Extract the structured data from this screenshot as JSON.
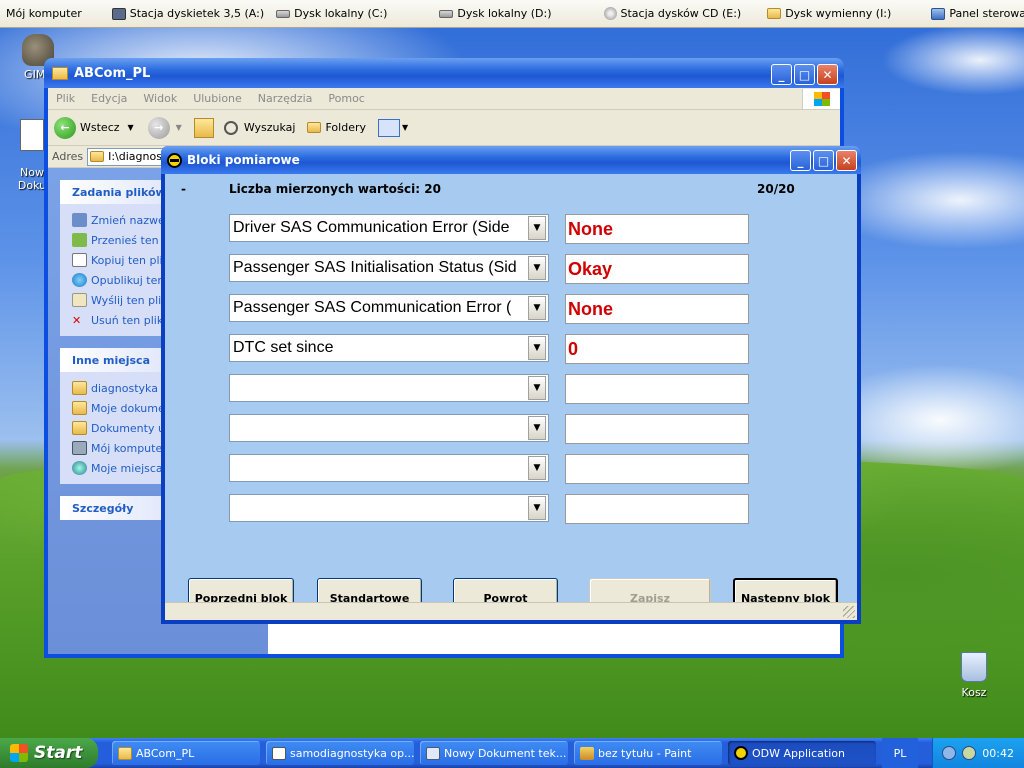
{
  "topbar": {
    "items": [
      {
        "label": "Mój komputer",
        "icon": "computer-icon"
      },
      {
        "label": "Stacja dyskietek 3,5 (A:)",
        "icon": "floppy-icon"
      },
      {
        "label": "Dysk lokalny (C:)",
        "icon": "drive-icon"
      },
      {
        "label": "Dysk lokalny (D:)",
        "icon": "drive-icon"
      },
      {
        "label": "Stacja dysków CD (E:)",
        "icon": "cd-icon"
      },
      {
        "label": "Dysk wymienny (I:)",
        "icon": "folder-icon"
      },
      {
        "label": "Panel sterowania",
        "icon": "control-panel-icon"
      }
    ]
  },
  "desktop_icons": [
    {
      "label": "GIMP"
    },
    {
      "label": "Now\nDoku"
    }
  ],
  "recycle_bin": {
    "label": "Kosz"
  },
  "explorer": {
    "title": "ABCom_PL",
    "menu": [
      "Plik",
      "Edycja",
      "Widok",
      "Ulubione",
      "Narzędzia",
      "Pomoc"
    ],
    "toolbar": {
      "back": "Wstecz",
      "search": "Wyszukaj",
      "folders": "Foldery"
    },
    "address_label": "Adres",
    "address_value": "I:\\diagnost",
    "file_tasks": {
      "title": "Zadania plików",
      "items": [
        "Zmień nazwę",
        "Przenieś ten p",
        "Kopiuj ten plik",
        "Opublikuj ten",
        "Wyślij ten plik",
        "Usuń ten plik"
      ]
    },
    "other_places": {
      "title": "Inne miejsca",
      "items": [
        "diagnostyka",
        "Moje dokume",
        "Dokumenty u",
        "Mój komputer",
        "Moje miejsca"
      ]
    },
    "details": {
      "title": "Szczegóły"
    }
  },
  "dialog": {
    "title": "Bloki pomiarowe",
    "dash": "-",
    "count_label": "Liczba mierzonych wartości: 20",
    "progress": "20/20",
    "rows": [
      {
        "name": "Driver SAS Communication Error (Side",
        "value": "None"
      },
      {
        "name": "Passenger SAS Initialisation Status (Sid",
        "value": "Okay"
      },
      {
        "name": "Passenger SAS Communication Error (",
        "value": "None"
      },
      {
        "name": "DTC set since",
        "value": "0"
      },
      {
        "name": "",
        "value": ""
      },
      {
        "name": "",
        "value": ""
      },
      {
        "name": "",
        "value": ""
      },
      {
        "name": "",
        "value": ""
      }
    ],
    "buttons": {
      "prev": "Poprzedni blok",
      "standard": "Standartowe",
      "back": "Powrot",
      "save": "Zapisz",
      "next": "Następny blok"
    }
  },
  "taskbar": {
    "start": "Start",
    "tasks": [
      {
        "label": "ABCom_PL",
        "active": false
      },
      {
        "label": "samodiagnostyka op...",
        "active": false
      },
      {
        "label": "Nowy Dokument tek...",
        "active": false
      },
      {
        "label": "bez tytułu - Paint",
        "active": false
      },
      {
        "label": "ODW Application",
        "active": true
      }
    ],
    "lang": "PL",
    "clock": "00:42"
  },
  "colors": {
    "value_text": "#d00000",
    "dialog_bg": "#a6caf0",
    "title_blue": "#2b6be0"
  }
}
